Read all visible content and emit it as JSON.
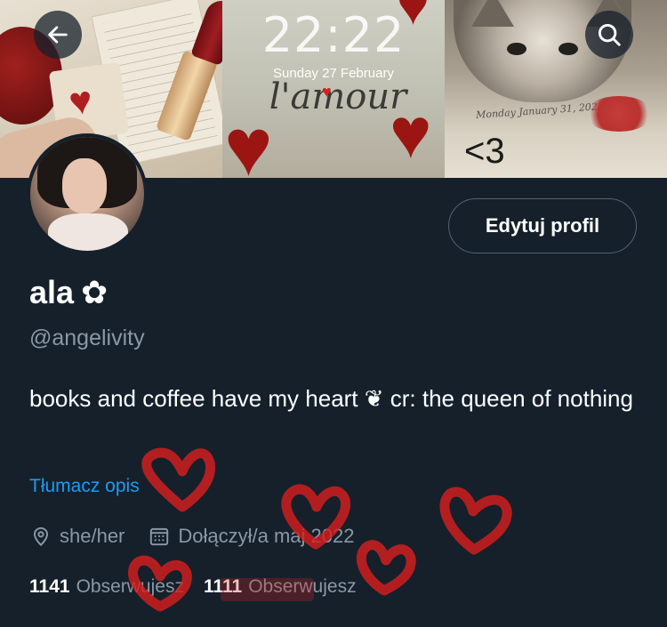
{
  "banner": {
    "lockscreen_time": "22:22",
    "lockscreen_date": "Sunday 27 February",
    "lockscreen_caption": "l'amour",
    "note_text": "Monday January 31, 2022",
    "note_heart_text": "<3"
  },
  "nav": {
    "back_icon": "arrow-left-icon",
    "search_icon": "search-icon"
  },
  "profile": {
    "edit_button": "Edytuj profil",
    "display_name": "ala",
    "display_name_emoji": "✿",
    "handle": "@angelivity",
    "bio": "books and coffee have my heart ❦ cr: the queen of nothing",
    "translate_link": "Tłumacz opis",
    "pronouns": "she/her",
    "joined": "Dołączył/a maj 2022",
    "stats": [
      {
        "count": "1141",
        "label": "Obserwujesz"
      },
      {
        "count": "1111",
        "label": "Obserwujesz"
      }
    ]
  },
  "colors": {
    "background": "#15202b",
    "secondary_text": "#8b98a5",
    "link": "#1d9bf0",
    "doodle_heart": "#d61f1f"
  }
}
